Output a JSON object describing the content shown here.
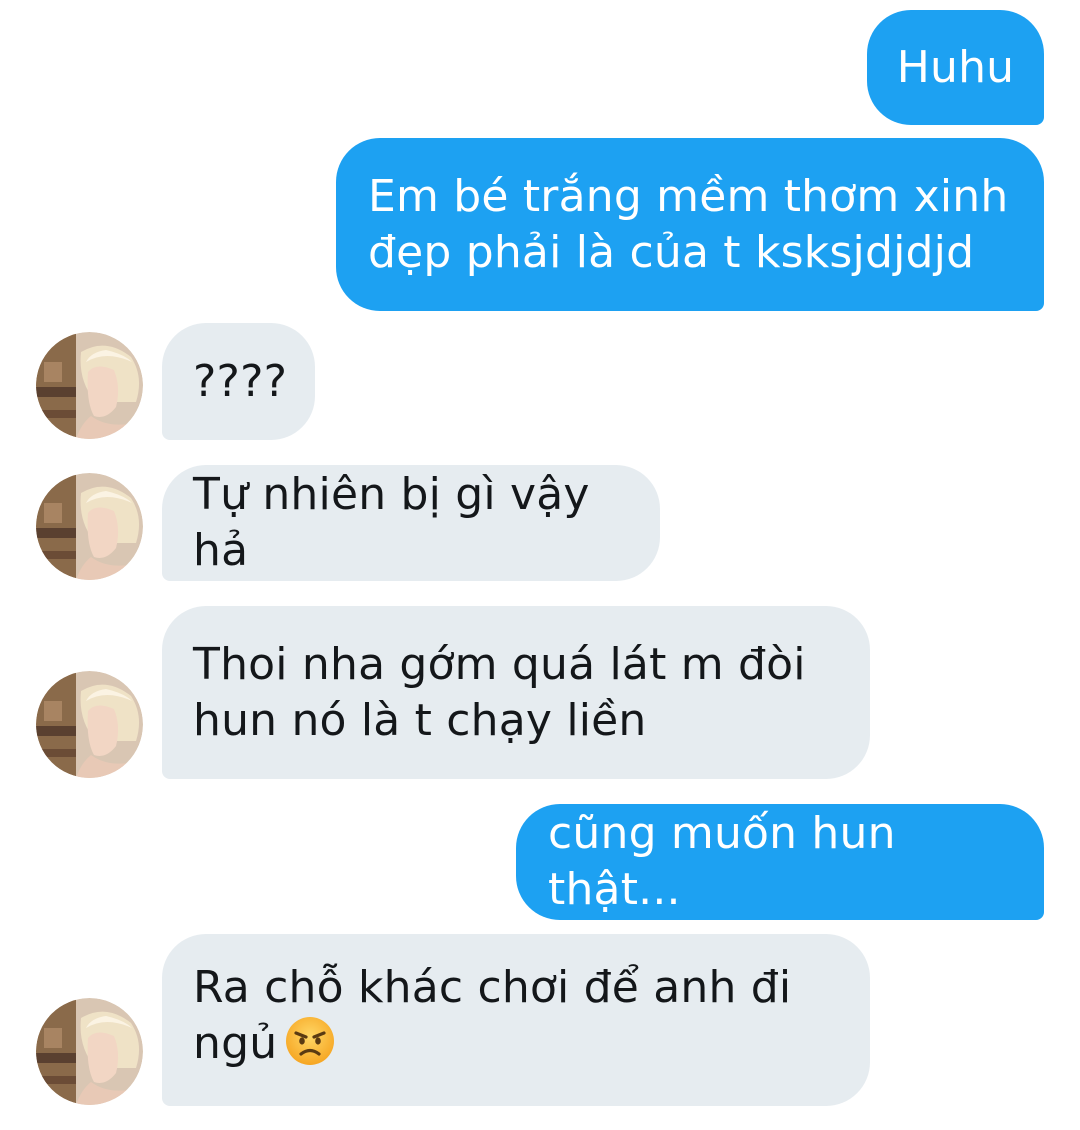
{
  "conversation": {
    "messages": [
      {
        "id": "m1",
        "side": "sent",
        "text": "Huhu"
      },
      {
        "id": "m2",
        "side": "sent",
        "text": "Em bé trắng mềm thơm xinh\nđẹp phải là của t ksksjdjdjd"
      },
      {
        "id": "m3",
        "side": "received",
        "text": "????"
      },
      {
        "id": "m4",
        "side": "received",
        "text": "Tự nhiên bị gì vậy hả"
      },
      {
        "id": "m5",
        "side": "received",
        "text": "Thoi nha gớm quá lát m đòi\nhun nó là t chạy liền"
      },
      {
        "id": "m6",
        "side": "sent",
        "text": "cũng muốn hun thật..."
      },
      {
        "id": "m7",
        "side": "received",
        "text": "Ra chỗ khác chơi để anh đi\nngủ",
        "emoji": "angry-face-emoji"
      }
    ]
  },
  "colors": {
    "sent_bubble": "#1da1f2",
    "received_bubble": "#e6ecf0",
    "sent_text": "#ffffff",
    "received_text": "#14171a"
  }
}
